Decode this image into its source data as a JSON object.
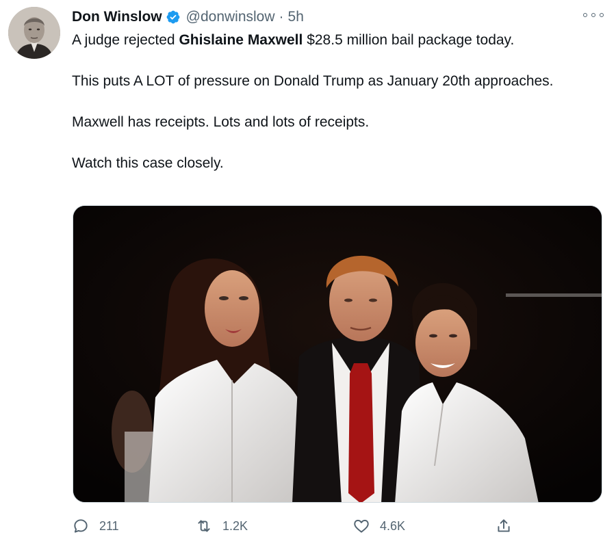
{
  "tweet": {
    "author_name": "Don Winslow",
    "handle": "@donwinslow",
    "separator": "·",
    "time": "5h",
    "text": {
      "line1_before": "A judge rejected ",
      "line1_bold": "Ghislaine Maxwell",
      "line1_after": " $28.5 million bail package today.",
      "para2": "This puts A LOT of pressure on Donald Trump as January 20th approaches.",
      "para3": "Maxwell has receipts. Lots and lots of receipts.",
      "para4": "Watch this case closely."
    }
  },
  "actions": {
    "reply_count": "211",
    "retweet_count": "1.2K",
    "like_count": "4.6K"
  },
  "icons": {
    "verified": "verified-badge-icon",
    "more": "more-options-icon",
    "reply": "reply-icon",
    "retweet": "retweet-icon",
    "like": "heart-icon",
    "share": "share-icon"
  },
  "colors": {
    "verified_blue": "#1d9bf0",
    "secondary_text": "#536471"
  }
}
